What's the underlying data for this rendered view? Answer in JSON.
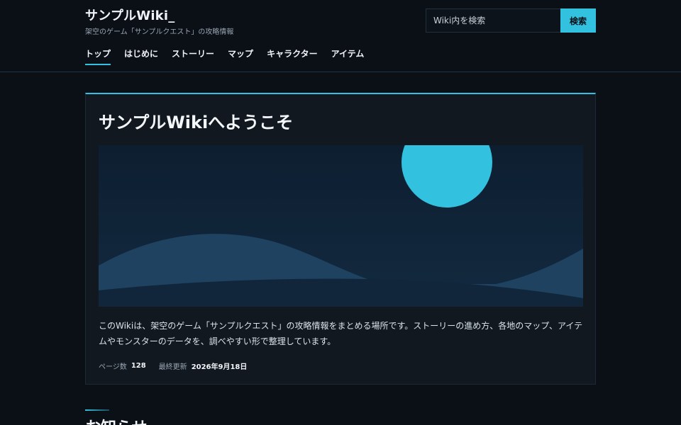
{
  "header": {
    "title": "サンプルWiki_",
    "subtitle": "架空のゲーム「サンプルクエスト」の攻略情報",
    "search": {
      "placeholder": "Wiki内を検索",
      "button_label": "検索"
    },
    "nav": [
      {
        "label": "トップ",
        "active": true
      },
      {
        "label": "はじめに"
      },
      {
        "label": "ストーリー"
      },
      {
        "label": "マップ"
      },
      {
        "label": "キャラクター"
      },
      {
        "label": "アイテム"
      }
    ]
  },
  "main": {
    "card": {
      "title": "サンプルWikiへようこそ",
      "text": "このWikiは、架空のゲーム「サンプルクエスト」の攻略情報をまとめる場所です。ストーリーの進め方、各地のマップ、アイテムやモンスターのデータを、調べやすい形で整理しています。",
      "meta": {
        "pages_label": "ページ数",
        "pages_value": "128",
        "updated_label": "最終更新",
        "updated_value": "2026年9月18日"
      }
    },
    "section_title": "お知らせ"
  },
  "colors": {
    "accent": "#33c1e0",
    "background": "#0b0f16",
    "card": "#111820"
  }
}
